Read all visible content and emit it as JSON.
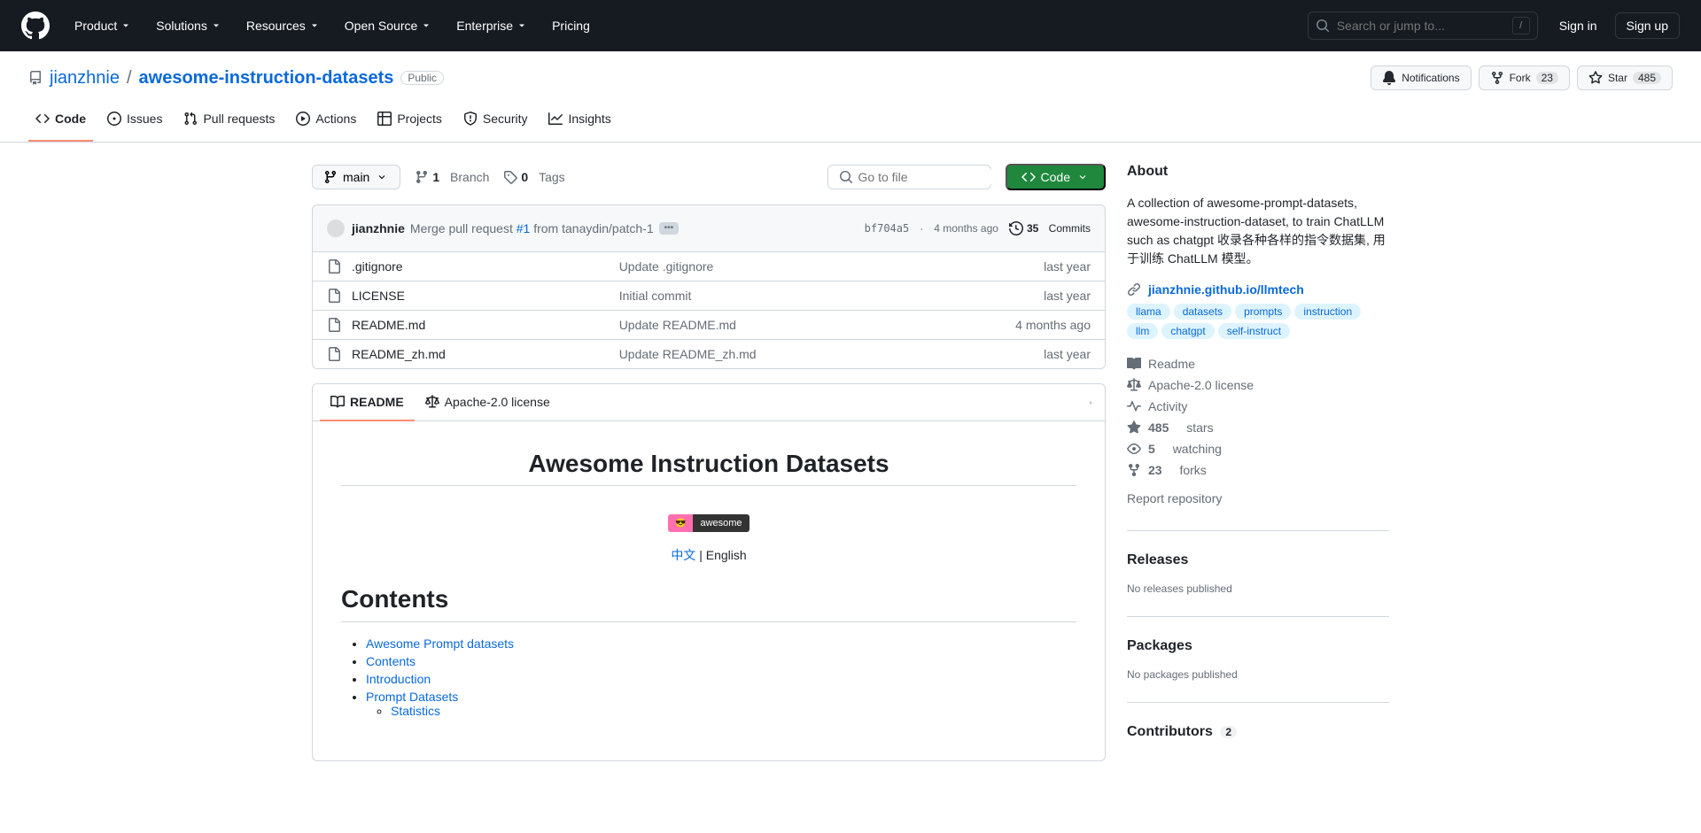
{
  "header": {
    "nav": [
      "Product",
      "Solutions",
      "Resources",
      "Open Source",
      "Enterprise",
      "Pricing"
    ],
    "search_placeholder": "Search or jump to...",
    "slash": "/",
    "sign_in": "Sign in",
    "sign_up": "Sign up"
  },
  "repo": {
    "owner": "jianzhnie",
    "name": "awesome-instruction-datasets",
    "visibility": "Public",
    "notifications": "Notifications",
    "fork": "Fork",
    "fork_count": "23",
    "star": "Star",
    "star_count": "485",
    "tabs": [
      "Code",
      "Issues",
      "Pull requests",
      "Actions",
      "Projects",
      "Security",
      "Insights"
    ]
  },
  "file_header": {
    "branch": "main",
    "branch_count": "1",
    "branch_label": "Branch",
    "tag_count": "0",
    "tag_label": "Tags",
    "go_to_file": "Go to file",
    "code_btn": "Code"
  },
  "commit_bar": {
    "author": "jianzhnie",
    "msg_pre": "Merge pull request ",
    "msg_link": "#1",
    "msg_post": " from tanaydin/patch-1",
    "sha": "bf704a5",
    "date": "4 months ago",
    "commits_count": "35",
    "commits_label": "Commits"
  },
  "files": [
    {
      "name": ".gitignore",
      "commit": "Update .gitignore",
      "date": "last year"
    },
    {
      "name": "LICENSE",
      "commit": "Initial commit",
      "date": "last year"
    },
    {
      "name": "README.md",
      "commit": "Update README.md",
      "date": "4 months ago"
    },
    {
      "name": "README_zh.md",
      "commit": "Update README_zh.md",
      "date": "last year"
    }
  ],
  "readme_tabs": {
    "readme": "README",
    "license": "Apache-2.0 license"
  },
  "readme": {
    "title": "Awesome Instruction Datasets",
    "awesome_badge": "awesome",
    "lang_zh": "中文",
    "lang_sep": " | ",
    "lang_en": "English",
    "contents_heading": "Contents",
    "toc": [
      "Awesome Prompt datasets",
      "Contents",
      "Introduction",
      "Prompt Datasets"
    ],
    "toc_sub": [
      "Statistics"
    ]
  },
  "about": {
    "heading": "About",
    "description": "A collection of awesome-prompt-datasets, awesome-instruction-dataset, to train ChatLLM such as chatgpt 收录各种各样的指令数据集, 用于训练 ChatLLM 模型。",
    "link": "jianzhnie.github.io/llmtech",
    "topics": [
      "llama",
      "datasets",
      "prompts",
      "instruction",
      "llm",
      "chatgpt",
      "self-instruct"
    ],
    "readme": "Readme",
    "license": "Apache-2.0 license",
    "activity": "Activity",
    "stars_count": "485",
    "stars_label": "stars",
    "watching_count": "5",
    "watching_label": "watching",
    "forks_count": "23",
    "forks_label": "forks",
    "report": "Report repository"
  },
  "releases": {
    "heading": "Releases",
    "subtext": "No releases published"
  },
  "packages": {
    "heading": "Packages",
    "subtext": "No packages published"
  },
  "contributors": {
    "heading": "Contributors",
    "count": "2"
  }
}
